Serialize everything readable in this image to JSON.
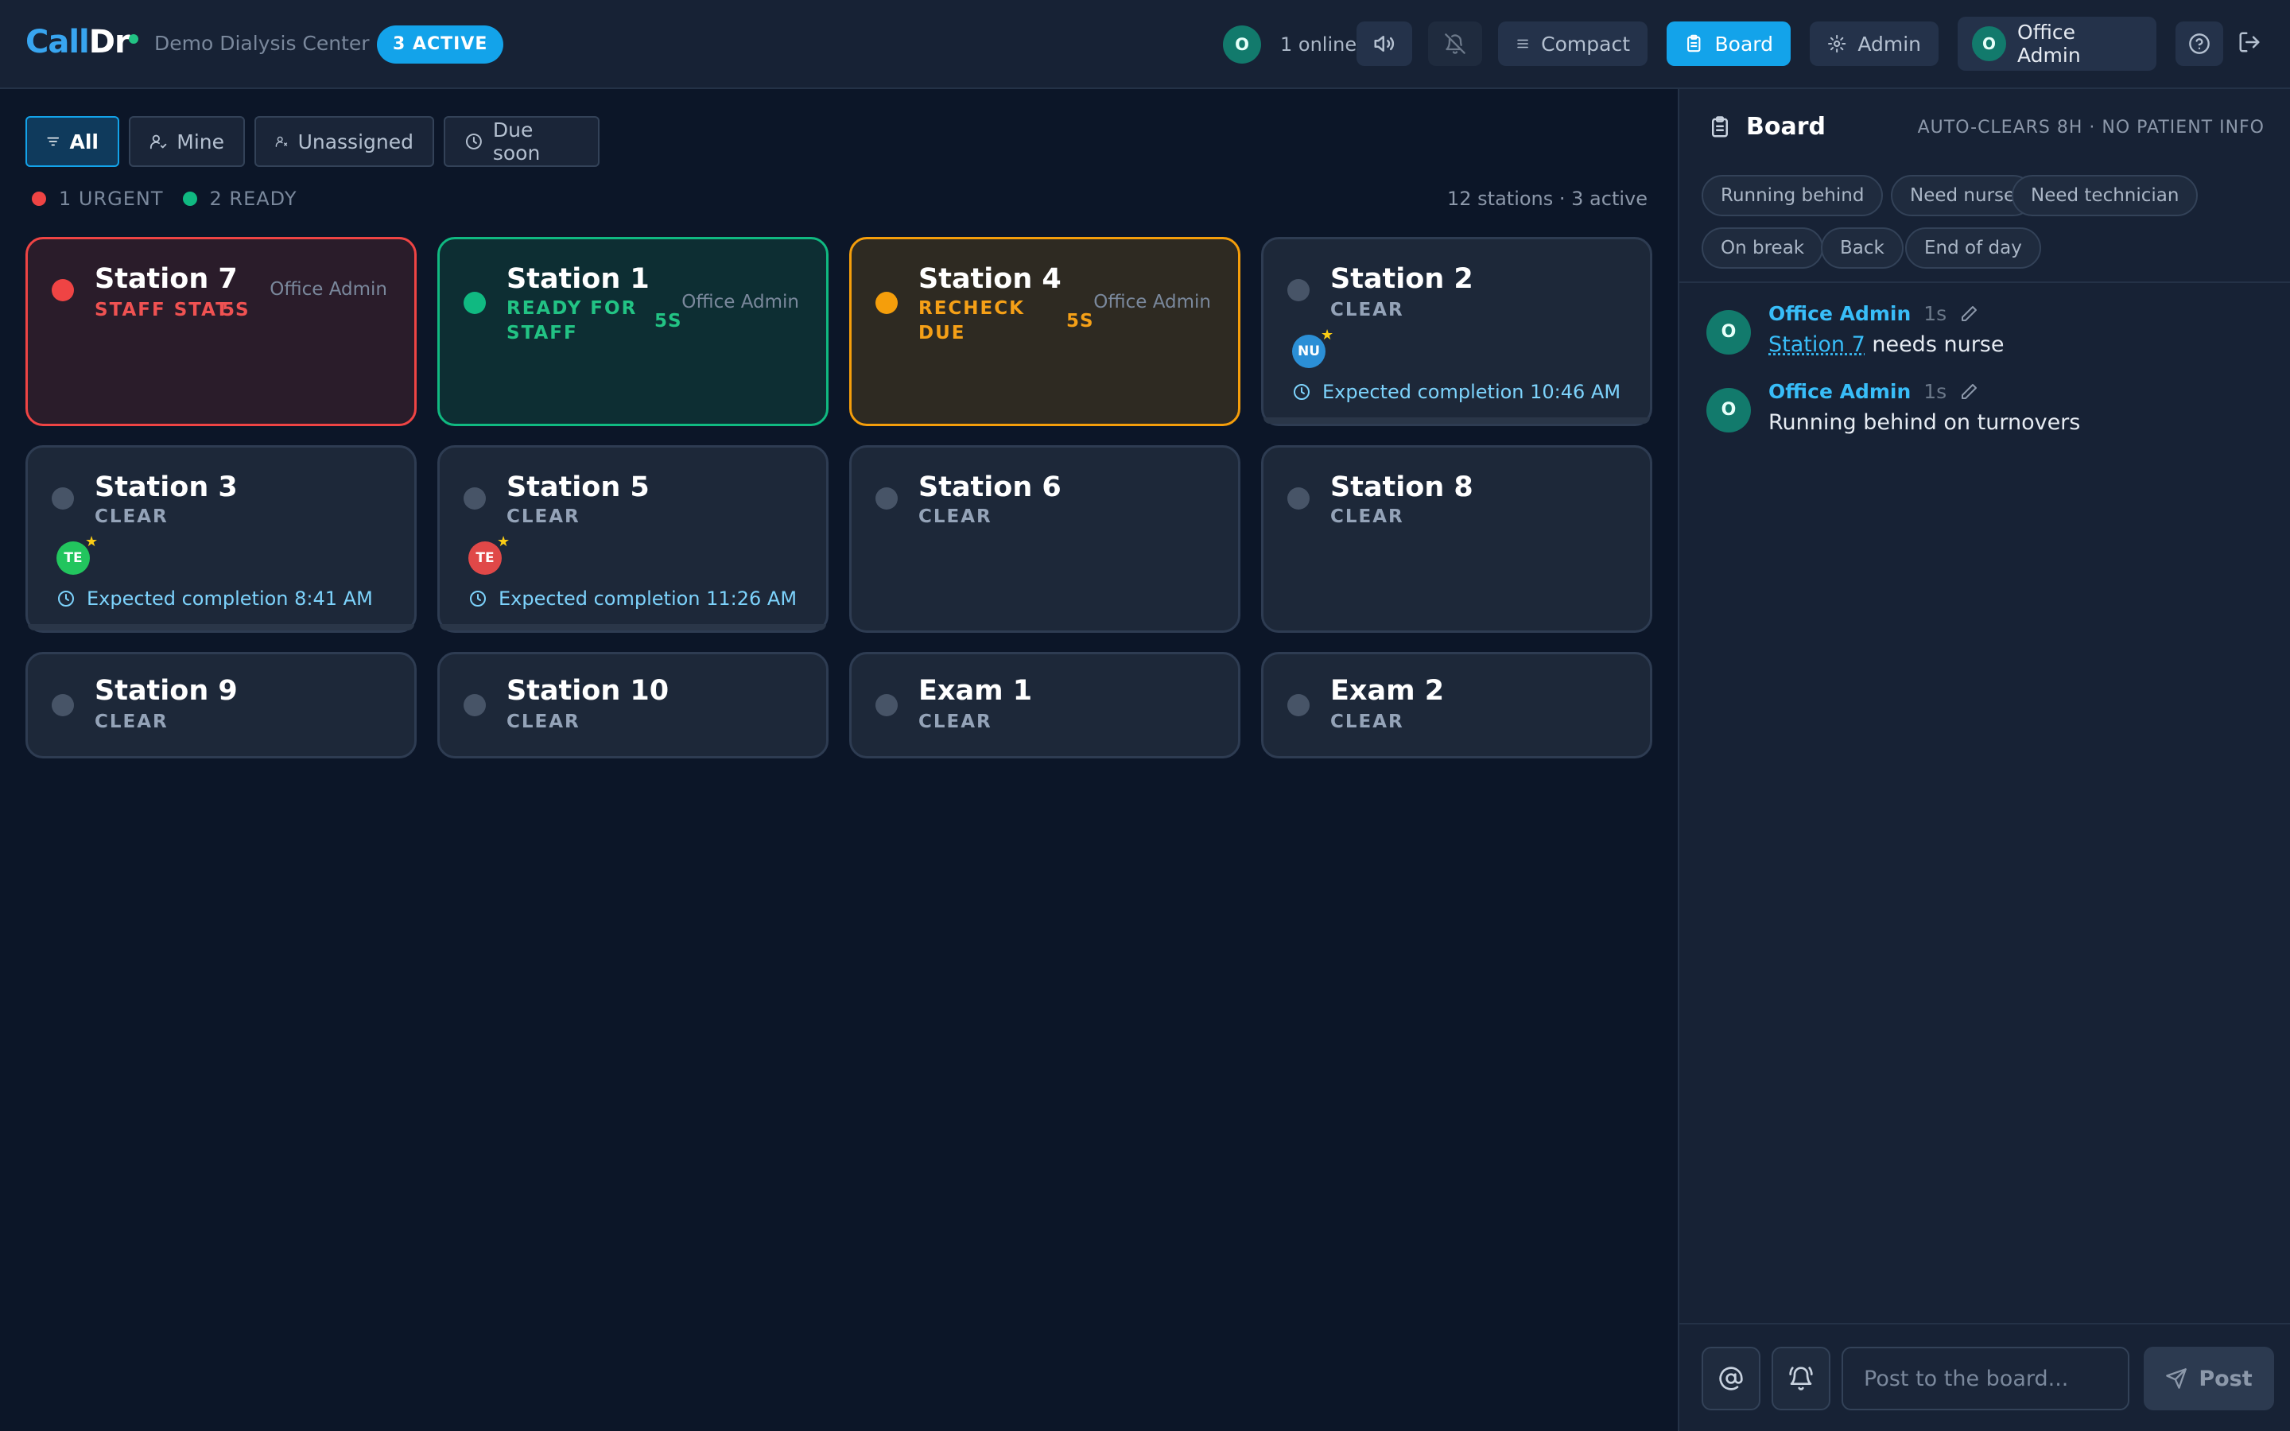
{
  "header": {
    "logo_part1": "Call",
    "logo_part2": "Dr",
    "center_name": "Demo Dialysis Center",
    "active_badge": "3 ACTIVE",
    "online_avatar": "O",
    "online_text": "1 online",
    "compact_label": "Compact",
    "board_label": "Board",
    "admin_label": "Admin",
    "user_initial": "O",
    "user_name": "Office Admin",
    "icons": [
      "volume-icon",
      "bell-off-icon",
      "menu-icon",
      "clipboard-icon",
      "gear-icon",
      "help-icon",
      "logout-icon"
    ]
  },
  "filters": [
    {
      "label": "All",
      "active": true
    },
    {
      "label": "Mine",
      "active": false
    },
    {
      "label": "Unassigned",
      "active": false
    },
    {
      "label": "Due soon",
      "active": false
    }
  ],
  "legend": {
    "urgent": "1 URGENT",
    "ready": "2 READY",
    "summary": "12 stations · 3 active"
  },
  "stations": [
    {
      "name": "Station 7",
      "status": "STAFF STAT",
      "elapsed": "5S",
      "owner": "Office Admin",
      "state": "urgent"
    },
    {
      "name": "Station 1",
      "status": "READY FOR STAFF",
      "elapsed": "5S",
      "owner": "Office Admin",
      "state": "ready"
    },
    {
      "name": "Station 4",
      "status": "RECHECK DUE",
      "elapsed": "5S",
      "owner": "Office Admin",
      "state": "recheck"
    },
    {
      "name": "Station 2",
      "status": "CLEAR",
      "staff": "NU",
      "expected": "Expected completion 10:46 AM",
      "state": "clear"
    },
    {
      "name": "Station 3",
      "status": "CLEAR",
      "staff": "TE",
      "expected": "Expected completion 8:41 AM",
      "state": "clear"
    },
    {
      "name": "Station 5",
      "status": "CLEAR",
      "staff": "TE",
      "expected": "Expected completion 11:26 AM",
      "state": "clear"
    },
    {
      "name": "Station 6",
      "status": "CLEAR",
      "state": "clear"
    },
    {
      "name": "Station 8",
      "status": "CLEAR",
      "state": "clear"
    },
    {
      "name": "Station 9",
      "status": "CLEAR",
      "state": "clear"
    },
    {
      "name": "Station 10",
      "status": "CLEAR",
      "state": "clear"
    },
    {
      "name": "Exam 1",
      "status": "CLEAR",
      "state": "clear"
    },
    {
      "name": "Exam 2",
      "status": "CLEAR",
      "state": "clear"
    }
  ],
  "staff_colors": {
    "NU": "#2b8fd6",
    "TE_green": "#22c55e",
    "TE_red": "#e04848"
  },
  "board": {
    "title": "Board",
    "note": "AUTO-CLEARS 8H · NO PATIENT INFO",
    "chips": [
      "Running behind",
      "Need nurse",
      "Need technician",
      "On break",
      "Back",
      "End of day"
    ],
    "messages": [
      {
        "initial": "O",
        "author": "Office Admin",
        "time": "1s",
        "link": "Station 7",
        "text": " needs nurse"
      },
      {
        "initial": "O",
        "author": "Office Admin",
        "time": "1s",
        "text": "Running behind on turnovers"
      }
    ],
    "composer_placeholder": "Post to the board...",
    "post_label": "Post"
  }
}
